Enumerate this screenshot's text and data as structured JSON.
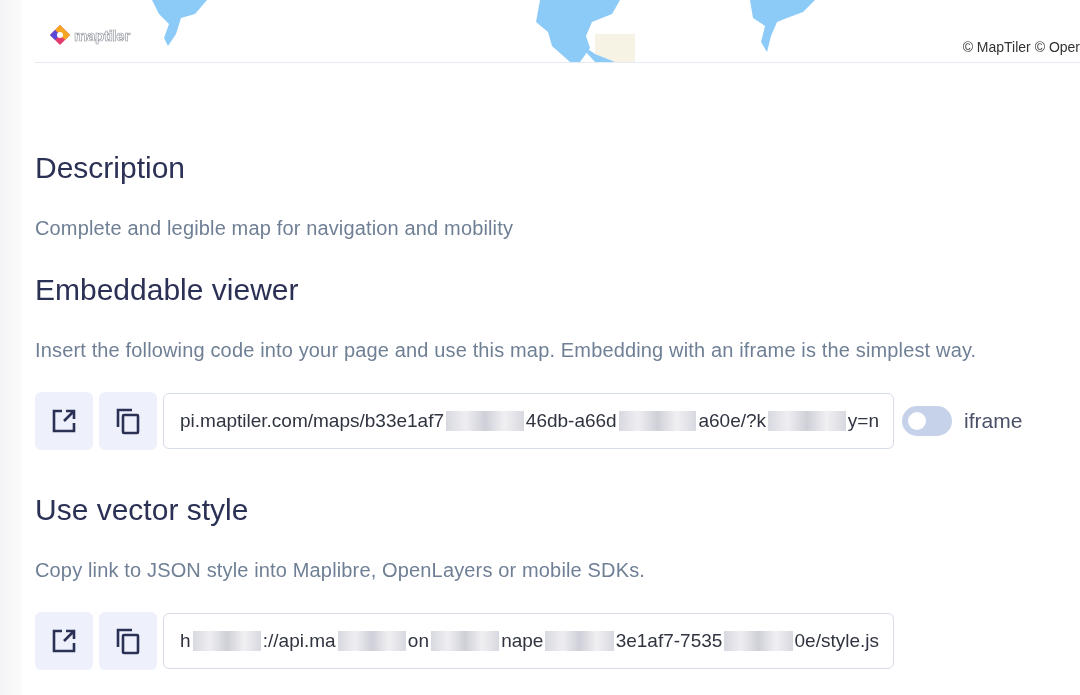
{
  "map": {
    "kind": "picture",
    "logo": "maptiler",
    "attribution": "© MapTiler © Oper"
  },
  "sections": [
    {
      "title": "Description",
      "text": "Complete and legible map for navigation and mobility"
    },
    {
      "title": "Embeddable viewer",
      "text": "Insert the following code into your page and use this map. Embedding with an iframe is the simplest way.",
      "link": {
        "value_parts": [
          "pi.maptiler.com/maps/b33e1af7",
          "46db-a66d",
          "a60e/?k",
          "y=n"
        ],
        "toggle": {
          "on": false,
          "label": "iframe"
        }
      }
    },
    {
      "title": "Use vector style",
      "text": "Copy link to JSON style into Maplibre, OpenLayers or mobile SDKs.",
      "link": {
        "value_parts": [
          "h",
          "://api.ma",
          "on",
          "nape",
          "3e1af7-7535",
          "0e/style.js"
        ]
      }
    }
  ]
}
